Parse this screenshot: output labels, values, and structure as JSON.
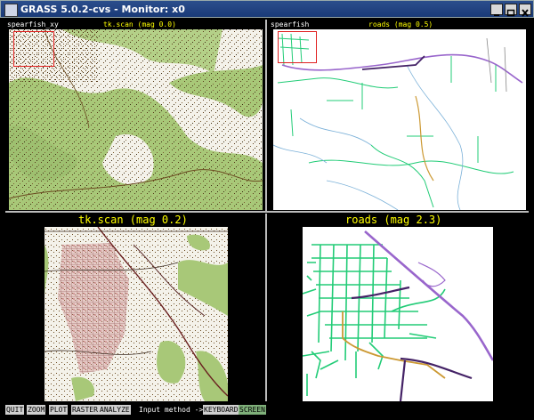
{
  "window": {
    "title": "GRASS 5.0.2-cvs - Monitor: x0",
    "buttons": [
      "minimize-icon",
      "maximize-icon",
      "close-icon"
    ]
  },
  "panels": {
    "top_left": {
      "location": "spearfish_xy",
      "label": "tk.scan (mag 0.0)"
    },
    "top_right": {
      "location": "spearfish",
      "label": "roads (mag 0.5)"
    },
    "bottom_left": {
      "label": "tk.scan (mag 0.2)"
    },
    "bottom_right": {
      "label": "roads (mag 2.3)"
    }
  },
  "menu": {
    "items": [
      "QUIT",
      "ZOOM",
      "PLOT",
      "RASTER",
      "ANALYZE"
    ],
    "input_method": "Input method ->",
    "keyboard": "KEYBOARD",
    "screen": "SCREEN"
  },
  "colors": {
    "title_bar": "#1a3a78",
    "panel_label": "#ffff00",
    "zoom_box": "#e02020",
    "vegetation": "#a8c878",
    "roads_green": "#22cc77",
    "roads_purple": "#9966cc",
    "roads_dark": "#442266",
    "roads_orange": "#cc9933",
    "map_red": "#cc8888"
  }
}
